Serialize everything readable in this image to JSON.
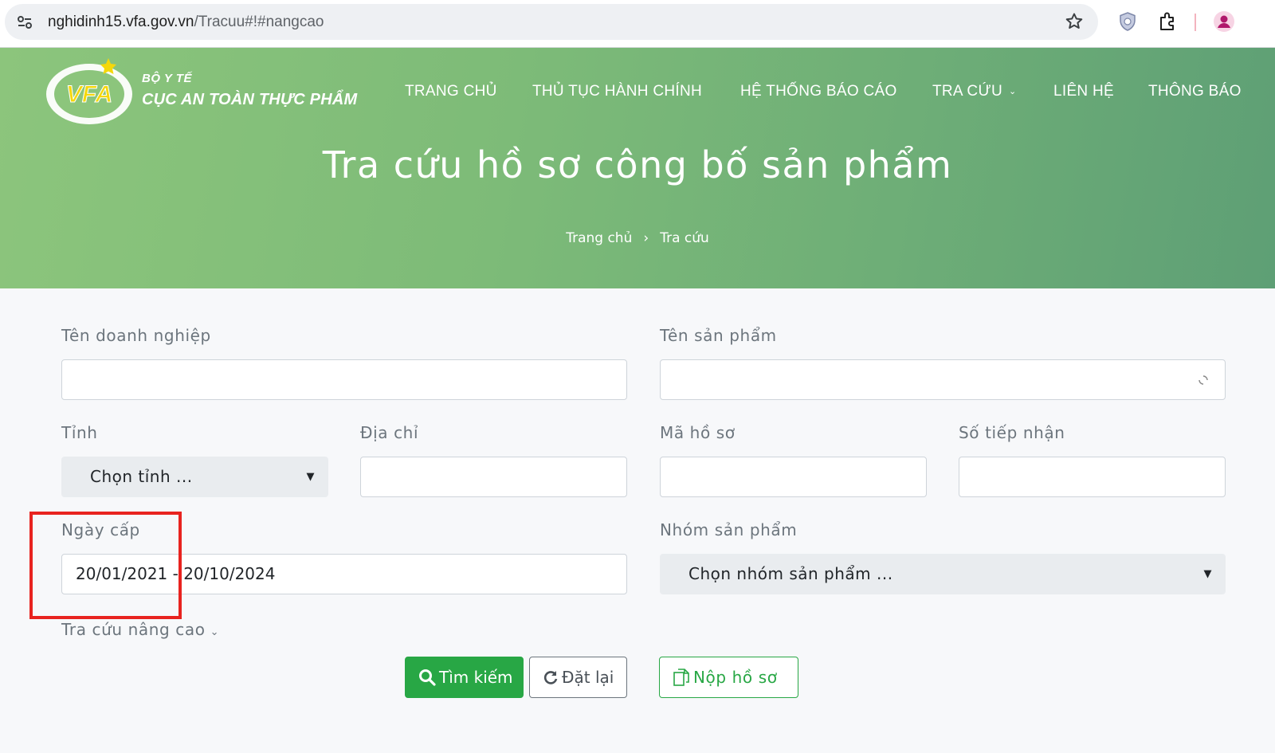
{
  "browser": {
    "url_host": "nghidinh15.vfa.gov.vn",
    "url_path": "/Tracuu#!#nangcao",
    "icons": [
      "site-info-icon",
      "star-icon",
      "shield-icon",
      "extensions-icon",
      "profile-icon"
    ]
  },
  "header": {
    "logo_text": "VFA",
    "logo_sub": "BỘ Y TẾ",
    "logo_main": "CỤC AN TOÀN THỰC PHẨM",
    "nav": [
      "TRANG CHỦ",
      "THỦ TỤC HÀNH CHÍNH",
      "HỆ THỐNG BÁO CÁO",
      "TRA CỨU",
      "LIÊN HỆ",
      "THÔNG BÁO"
    ],
    "title": "Tra cứu hồ sơ công bố sản phẩm",
    "breadcrumb": [
      "Trang chủ",
      "›",
      "Tra cứu"
    ]
  },
  "form": {
    "company_label": "Tên doanh nghiệp",
    "company_value": "",
    "product_label": "Tên sản phẩm",
    "product_value": "",
    "province_label": "Tỉnh",
    "province_value": "Chọn tỉnh ...",
    "address_label": "Địa chỉ",
    "address_value": "",
    "file_code_label": "Mã hồ sơ",
    "file_code_value": "",
    "receipt_no_label": "Số tiếp nhận",
    "receipt_no_value": "",
    "issue_date_label": "Ngày cấp",
    "issue_date_value": "20/01/2021 - 20/10/2024",
    "product_group_label": "Nhóm sản phẩm",
    "product_group_value": "Chọn nhóm sản phẩm ...",
    "advanced_label": "Tra cứu nâng cao",
    "search_button": "Tìm kiếm",
    "reset_button": "Đặt lại",
    "submit_button": "Nộp hồ sơ"
  },
  "colors": {
    "hero_start": "#8cc57c",
    "hero_end": "#5e9f75",
    "primary_green": "#28a745",
    "highlight_red": "#e8231f"
  }
}
